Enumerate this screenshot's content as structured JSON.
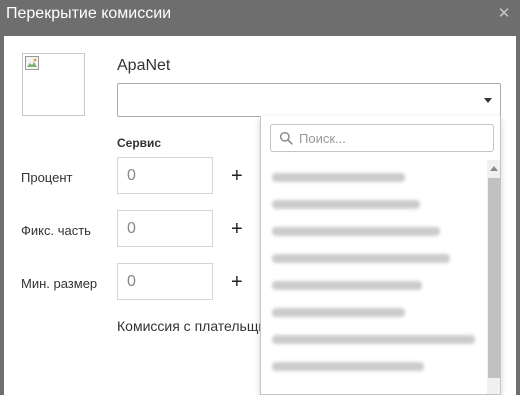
{
  "dialog": {
    "title": "Перекрытие комиссии",
    "close_icon": "close-icon"
  },
  "provider": {
    "name": "ApaNet",
    "selected_value": ""
  },
  "columns": {
    "service": "Сервис"
  },
  "rows": [
    {
      "label": "Процент",
      "value": "0",
      "action": "+"
    },
    {
      "label": "Фикс. часть",
      "value": "0",
      "action": "+"
    },
    {
      "label": "Мин. размер",
      "value": "0",
      "action": "+"
    }
  ],
  "footer": {
    "text": "Комиссия с плательщи"
  },
  "dropdown": {
    "search_placeholder": "Поиск...",
    "options_blurred": true,
    "option_count": 8
  },
  "colors": {
    "titlebar": "#6e6e6e",
    "body": "#ffffff",
    "border": "#c4c4c4",
    "scroll_thumb": "#c1c1c1"
  }
}
